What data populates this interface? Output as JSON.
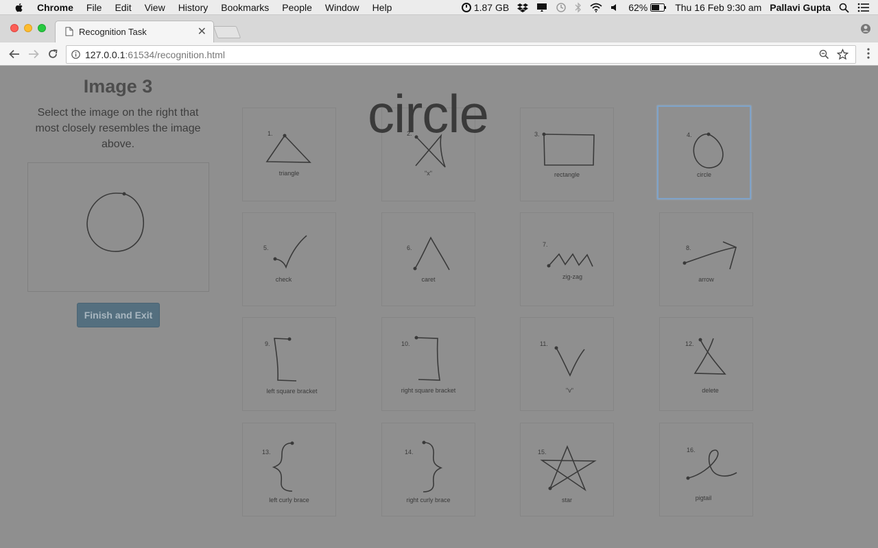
{
  "menubar": {
    "app": "Chrome",
    "items": [
      "File",
      "Edit",
      "View",
      "History",
      "Bookmarks",
      "People",
      "Window",
      "Help"
    ],
    "memory": "1.87 GB",
    "battery": "62%",
    "datetime": "Thu 16 Feb  9:30 am",
    "user": "Pallavi Gupta"
  },
  "browser": {
    "tab_title": "Recognition Task",
    "url_host": "127.0.0.1",
    "url_rest": ":61534/recognition.html"
  },
  "task": {
    "heading": "Image 3",
    "instructions": "Select the image on the right that most closely resembles the image above.",
    "finish_label": "Finish and Exit",
    "overlay_word": "circle"
  },
  "gestures": [
    {
      "num": "1.",
      "label": "triangle"
    },
    {
      "num": "2.",
      "label": "\"x\""
    },
    {
      "num": "3.",
      "label": "rectangle"
    },
    {
      "num": "4.",
      "label": "circle",
      "selected": true
    },
    {
      "num": "5.",
      "label": "check"
    },
    {
      "num": "6.",
      "label": "caret"
    },
    {
      "num": "7.",
      "label": "zig-zag"
    },
    {
      "num": "8.",
      "label": "arrow"
    },
    {
      "num": "9.",
      "label": "left square bracket"
    },
    {
      "num": "10.",
      "label": "right square bracket"
    },
    {
      "num": "11.",
      "label": "\"v\""
    },
    {
      "num": "12.",
      "label": "delete"
    },
    {
      "num": "13.",
      "label": "left curly brace"
    },
    {
      "num": "14.",
      "label": "right curly brace"
    },
    {
      "num": "15.",
      "label": "star"
    },
    {
      "num": "16.",
      "label": "pigtail"
    }
  ]
}
